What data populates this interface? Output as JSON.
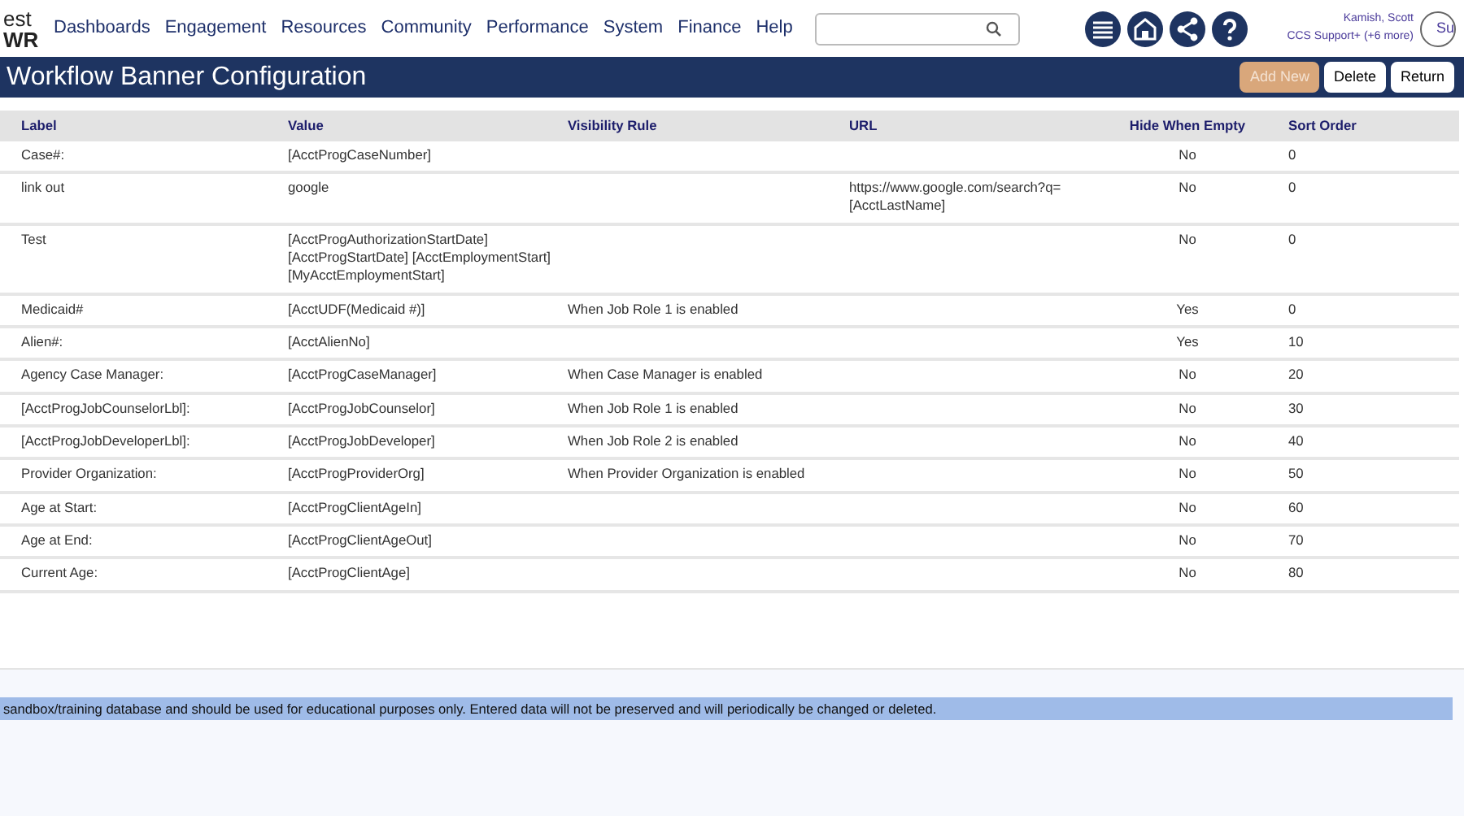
{
  "logo": {
    "line_1": "est",
    "line_2": "WR"
  },
  "nav": [
    "Dashboards",
    "Engagement",
    "Resources",
    "Community",
    "Performance",
    "System",
    "Finance",
    "Help"
  ],
  "user": {
    "name": "Kamish, Scott",
    "role": "CCS Support+ (+6 more)",
    "avatar_text": "Su"
  },
  "page_title": "Workflow Banner Configuration",
  "buttons": [
    {
      "label": "Add New",
      "highlighted": true
    },
    {
      "label": "Delete",
      "highlighted": false
    },
    {
      "label": "Return",
      "highlighted": false
    }
  ],
  "table": {
    "columns": [
      "Label",
      "Value",
      "Visibility Rule",
      "URL",
      "Hide When Empty",
      "Sort Order"
    ],
    "rows": [
      [
        "Case#:",
        "[AcctProgCaseNumber]",
        "",
        "",
        "No",
        "0"
      ],
      [
        "link out",
        "google",
        "",
        "https://www.google.com/search?q=\n[AcctLastName]",
        "No",
        "0"
      ],
      [
        "Test",
        "[AcctProgAuthorizationStartDate]\n[AcctProgStartDate] [AcctEmploymentStart]\n[MyAcctEmploymentStart]",
        "",
        "",
        "No",
        "0"
      ],
      [
        "Medicaid#",
        "[AcctUDF(Medicaid #)]",
        "When Job Role 1 is enabled",
        "",
        "Yes",
        "0"
      ],
      [
        "Alien#:",
        "[AcctAlienNo]",
        "",
        "",
        "Yes",
        "10"
      ],
      [
        "Agency Case Manager:",
        "[AcctProgCaseManager]",
        "When Case Manager is enabled",
        "",
        "No",
        "20"
      ],
      [
        "[AcctProgJobCounselorLbl]:",
        "[AcctProgJobCounselor]",
        "When Job Role 1 is enabled",
        "",
        "No",
        "30"
      ],
      [
        "[AcctProgJobDeveloperLbl]:",
        "[AcctProgJobDeveloper]",
        "When Job Role 2 is enabled",
        "",
        "No",
        "40"
      ],
      [
        "Provider Organization:",
        "[AcctProgProviderOrg]",
        "When Provider Organization is enabled",
        "",
        "No",
        "50"
      ],
      [
        "Age at Start:",
        "[AcctProgClientAgeIn]",
        "",
        "",
        "No",
        "60"
      ],
      [
        "Age at End:",
        "[AcctProgClientAgeOut]",
        "",
        "",
        "No",
        "70"
      ],
      [
        "Current Age:",
        "[AcctProgClientAge]",
        "",
        "",
        "No",
        "80"
      ]
    ]
  },
  "footer_notice": "sandbox/training database and should be used for educational purposes only. Entered data will not be preserved and will periodically be changed or deleted."
}
